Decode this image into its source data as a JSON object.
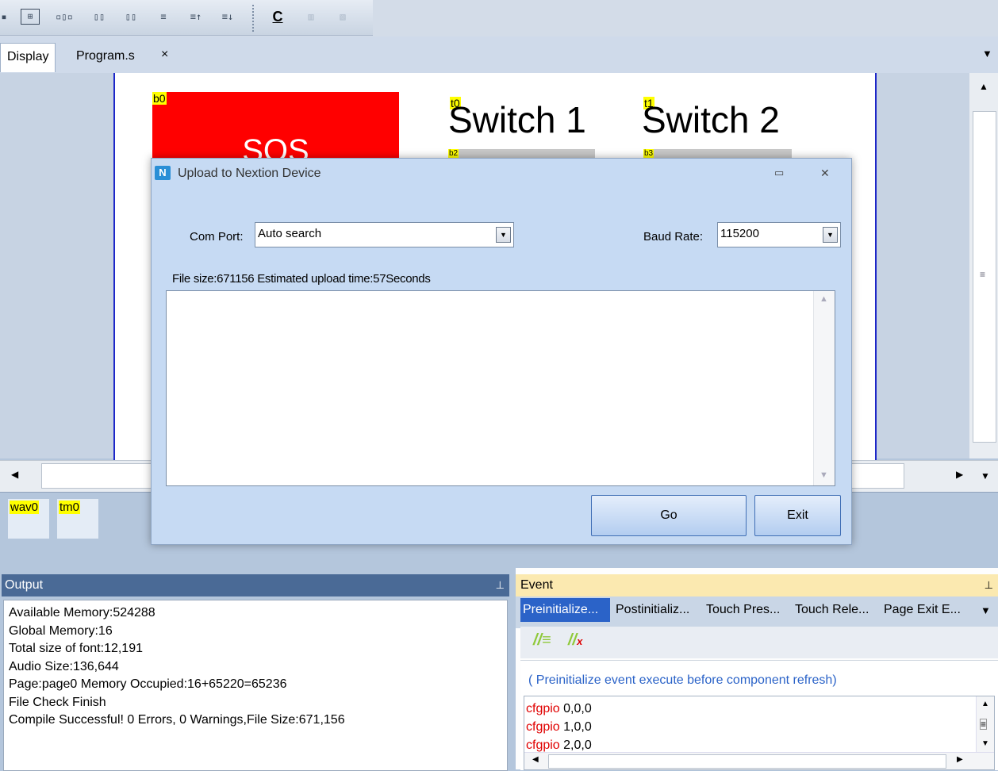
{
  "toolbar": {
    "icons": [
      "align-icon",
      "grid-icon",
      "distribute-h-icon",
      "same-width-icon",
      "same-width-2-icon",
      "align-v-icon",
      "bring-up-icon",
      "send-down-icon",
      "c-bold-icon",
      "disabled-icon",
      "disabled-close-icon"
    ],
    "c_label": "C"
  },
  "tabs": {
    "display": "Display",
    "program": "Program.s",
    "close_glyph": "×",
    "overflow_glyph": "▼"
  },
  "canvas": {
    "b0_tag": "b0",
    "b0_text": "SOS",
    "t0_tag": "t0",
    "t0_text": "Switch 1",
    "t1_tag": "t1",
    "t1_text": "Switch 2",
    "b2_tag": "b2",
    "b3_tag": "b3",
    "b0_color": "#ff0000"
  },
  "nonvisual": {
    "items": [
      "wav0",
      "tm0"
    ]
  },
  "dialog": {
    "title": "Upload to Nextion Device",
    "com_port_label": "Com Port:",
    "com_port_value": "Auto search",
    "baud_rate_label": "Baud Rate:",
    "baud_rate_value": "115200",
    "file_info": "File size:671156 Estimated upload time:57Seconds",
    "go_label": "Go",
    "exit_label": "Exit",
    "minimize_glyph": "▭",
    "close_glyph": "✕"
  },
  "output": {
    "title": "Output",
    "pin_glyph": "⊥",
    "lines": [
      "Available Memory:524288",
      "Global Memory:16",
      "Total size of font:12,191",
      "Audio Size:136,644",
      "Page:page0 Memory Occupied:16+65220=65236",
      "File Check Finish",
      "Compile Successful! 0 Errors, 0 Warnings,File Size:671,156"
    ]
  },
  "event": {
    "title": "Event",
    "pin_glyph": "⊥",
    "tabs": [
      "Preinitialize...",
      "Postinitializ...",
      "Touch Pres...",
      "Touch Rele...",
      "Page Exit E..."
    ],
    "overflow_glyph": "▼",
    "description": "( Preinitialize event execute before component refresh)",
    "code": [
      {
        "kw": "cfgpio",
        "args": " 0,0,0"
      },
      {
        "kw": "cfgpio",
        "args": " 1,0,0"
      },
      {
        "kw": "cfgpio",
        "args": " 2,0,0"
      }
    ],
    "accent_color": "#2b63c8",
    "keyword_color": "#e00000"
  }
}
